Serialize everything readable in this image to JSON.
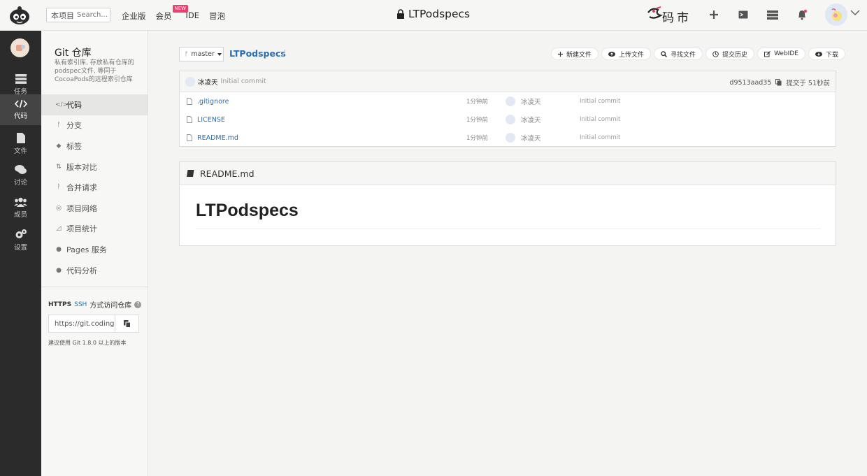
{
  "header": {
    "search_scope": "本项目",
    "search_placeholder": "Search...",
    "nav": [
      "企业版",
      "会员",
      "IDE",
      "冒泡"
    ],
    "new_badge": "NEW",
    "repo_title": "LTPodspecs",
    "brand": "码市"
  },
  "rail": {
    "items": [
      {
        "label": "任务",
        "icon": "tasks-icon"
      },
      {
        "label": "代码",
        "icon": "code-icon"
      },
      {
        "label": "文件",
        "icon": "file-icon"
      },
      {
        "label": "讨论",
        "icon": "chat-icon"
      },
      {
        "label": "成员",
        "icon": "members-icon"
      },
      {
        "label": "设置",
        "icon": "settings-icon"
      }
    ],
    "active": "代码"
  },
  "sidebar": {
    "title": "Git 仓库",
    "description": "私有索引库, 存放私有仓库的podspec文件, 等同于CocoaPods的远程索引仓库",
    "menu": [
      {
        "glyph": "</>",
        "label": "代码"
      },
      {
        "glyph": "ᚠ",
        "label": "分支"
      },
      {
        "glyph": "◆",
        "label": "标签"
      },
      {
        "glyph": "⇅",
        "label": "版本对比"
      },
      {
        "glyph": "ᚹ",
        "label": "合并请求"
      },
      {
        "glyph": "◎",
        "label": "项目网络"
      },
      {
        "glyph": "◿",
        "label": "项目统计"
      },
      {
        "glyph": "●",
        "label": "Pages 服务"
      },
      {
        "glyph": "●",
        "label": "代码分析"
      }
    ],
    "active": "代码",
    "access": {
      "https": "HTTPS",
      "ssh": "SSH",
      "text": "方式访问仓库",
      "clone_url": "https://git.coding",
      "hint": "建议使用 Git 1.8.0 以上的版本"
    }
  },
  "main": {
    "branch": "master",
    "repo_name": "LTPodspecs",
    "actions": [
      {
        "icon": "plus-icon",
        "label": "新建文件"
      },
      {
        "icon": "upload-icon",
        "label": "上传文件"
      },
      {
        "icon": "search-icon",
        "label": "寻找文件"
      },
      {
        "icon": "history-icon",
        "label": "提交历史"
      },
      {
        "icon": "edit-icon",
        "label": "WebIDE"
      },
      {
        "icon": "download-icon",
        "label": "下载"
      }
    ],
    "last_commit": {
      "author": "冰凌天",
      "message": "Initial commit",
      "hash": "d9513aad35",
      "committed": "提交于 51秒前"
    },
    "files": [
      {
        "name": ".gitignore",
        "time": "1分钟前",
        "author": "冰凌天",
        "message": "Initial commit"
      },
      {
        "name": "LICENSE",
        "time": "1分钟前",
        "author": "冰凌天",
        "message": "Initial commit"
      },
      {
        "name": "README.md",
        "time": "1分钟前",
        "author": "冰凌天",
        "message": "Initial commit"
      }
    ],
    "readme": {
      "filename": "README.md",
      "heading": "LTPodspecs"
    }
  },
  "colors": {
    "link": "#2a6fb5",
    "rail_bg": "#2b2b2b",
    "badge": "#ef3d6e"
  }
}
